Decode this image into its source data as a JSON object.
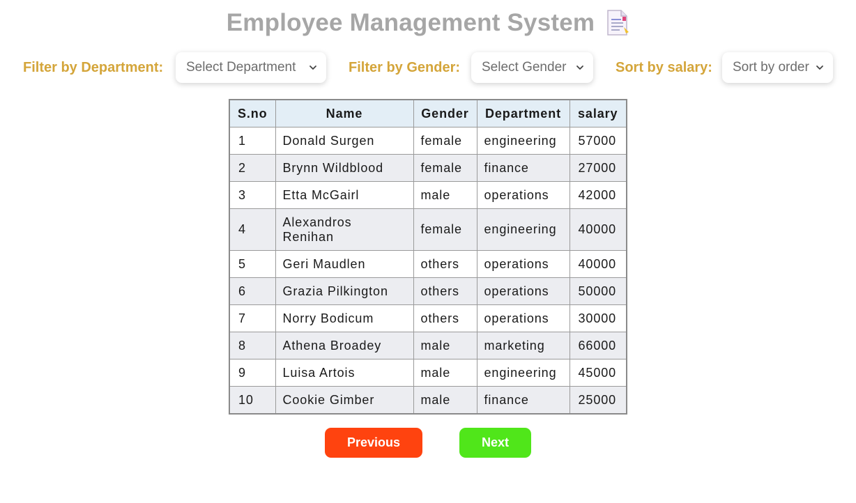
{
  "header": {
    "title": "Employee Management System"
  },
  "filters": {
    "department": {
      "label": "Filter by Department:",
      "selected": "Select Department"
    },
    "gender": {
      "label": "Filter by Gender:",
      "selected": "Select Gender"
    },
    "salary": {
      "label": "Sort by salary:",
      "selected": "Sort by order"
    }
  },
  "table": {
    "columns": [
      "S.no",
      "Name",
      "Gender",
      "Department",
      "salary"
    ],
    "rows": [
      [
        "1",
        "Donald Surgen",
        "female",
        "engineering",
        "57000"
      ],
      [
        "2",
        "Brynn Wildblood",
        "female",
        "finance",
        "27000"
      ],
      [
        "3",
        "Etta McGairl",
        "male",
        "operations",
        "42000"
      ],
      [
        "4",
        "Alexandros Renihan",
        "female",
        "engineering",
        "40000"
      ],
      [
        "5",
        "Geri Maudlen",
        "others",
        "operations",
        "40000"
      ],
      [
        "6",
        "Grazia Pilkington",
        "others",
        "operations",
        "50000"
      ],
      [
        "7",
        "Norry Bodicum",
        "others",
        "operations",
        "30000"
      ],
      [
        "8",
        "Athena Broadey",
        "male",
        "marketing",
        "66000"
      ],
      [
        "9",
        "Luisa Artois",
        "male",
        "engineering",
        "45000"
      ],
      [
        "10",
        "Cookie Gimber",
        "male",
        "finance",
        "25000"
      ]
    ]
  },
  "pagination": {
    "previous_label": "Previous",
    "next_label": "Next"
  },
  "colors": {
    "title": "#a6a6a6",
    "filter_label": "#d4a53a",
    "header_bg": "#e3eef6",
    "stripe_bg": "#ecedf1",
    "previous_button": "#ff430f",
    "next_button": "#50e61a"
  },
  "icons": {
    "title_icon": "document-icon",
    "select_chevron": "chevron-down-icon"
  }
}
